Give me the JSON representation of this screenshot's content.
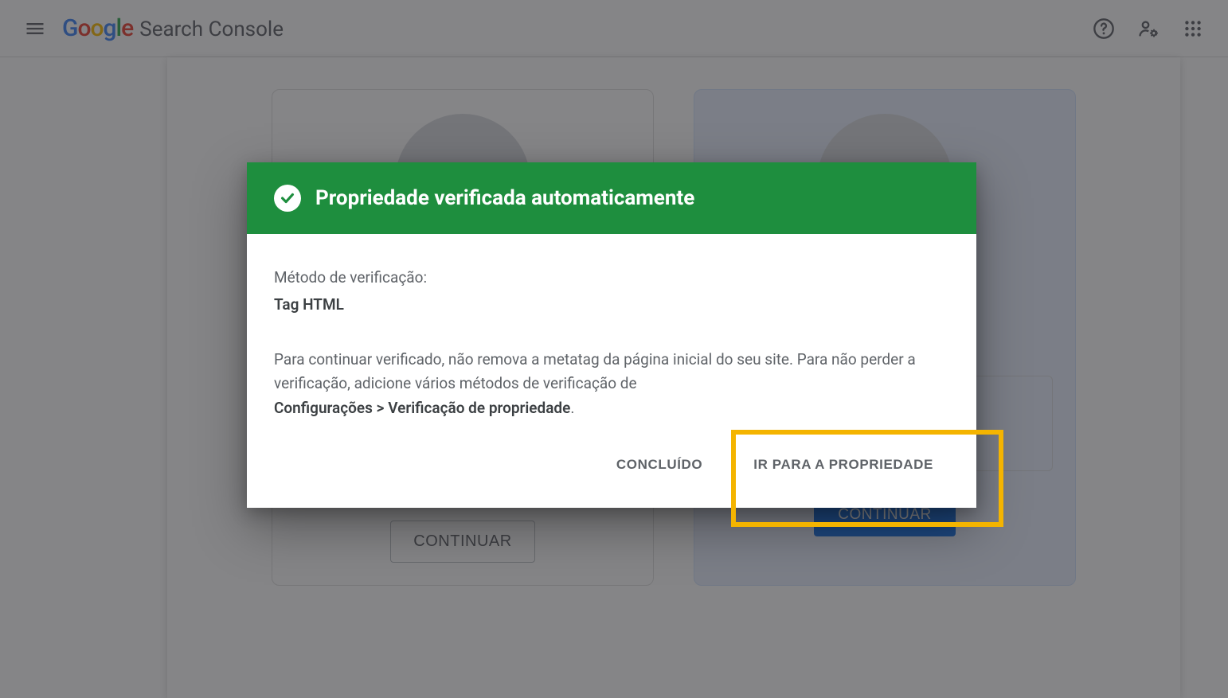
{
  "brand": {
    "logo_letters": [
      "G",
      "o",
      "o",
      "g",
      "l",
      "e"
    ],
    "app_title": "Search Console"
  },
  "header_icons": {
    "menu": "menu-icon",
    "help": "help-icon",
    "users": "users-icon",
    "apps": "apps-icon"
  },
  "cards": {
    "left": {
      "continue_label": "CONTINUAR"
    },
    "right": {
      "continue_label": "CONTINUAR"
    }
  },
  "modal": {
    "title": "Propriedade verificada automaticamente",
    "method_label": "Método de verificação:",
    "method_value": "Tag HTML",
    "paragraph_pre": "Para continuar verificado, não remova a metatag da página inicial do seu site. Para não perder a verificação, adicione vários métodos de verificação de ",
    "paragraph_strong": "Configurações > Verificação de propriedade",
    "paragraph_post": ".",
    "done_label": "CONCLUÍDO",
    "go_label": "IR PARA A PROPRIEDADE"
  },
  "colors": {
    "success_green": "#1e8e3e",
    "highlight_yellow": "#f4b400"
  }
}
